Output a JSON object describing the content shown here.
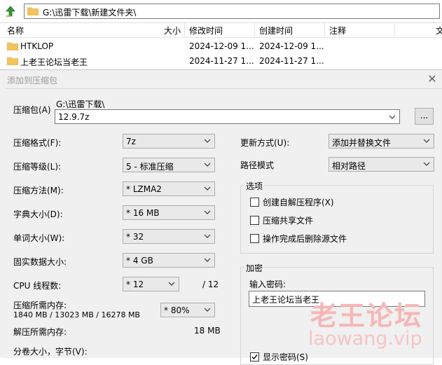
{
  "explorer": {
    "path": "G:\\迅雷下载\\新建文件夹\\",
    "columns": {
      "name": "名称",
      "size": "大小",
      "modified": "修改时间",
      "created": "创建时间",
      "comment": "注释",
      "extra": "文"
    },
    "rows": [
      {
        "name": "HTKLOP",
        "modified": "2024-12-09 1...",
        "created": "2024-12-09 1..."
      },
      {
        "name": "上老王论坛当老王",
        "modified": "2024-11-27 1...",
        "created": "2024-11-27 1..."
      }
    ]
  },
  "dialog": {
    "title": "添加到压缩包",
    "archive_label": "压缩包(A)",
    "archive_dir": "G:\\迅雷下载\\",
    "archive_name": "12.9.7z",
    "browse_label": "...",
    "format_label": "压缩格式(F):",
    "format_value": "7z",
    "level_label": "压缩等级(L):",
    "level_value": "5 - 标准压缩",
    "method_label": "压缩方法(M):",
    "method_value": "* LZMA2",
    "dict_label": "字典大小(D):",
    "dict_value": "* 16 MB",
    "word_label": "单词大小(W):",
    "word_value": "* 32",
    "solid_label": "固实数据大小:",
    "solid_value": "* 4 GB",
    "threads_label": "CPU 线程数:",
    "threads_value": "* 12",
    "threads_total": "/ 12",
    "mem_label": "压缩所需内存:",
    "mem_value": "1840 MB / 13023 MB / 16278 MB",
    "mem_percent": "* 80%",
    "decomp_label": "解压所需内存:",
    "decomp_value": "18 MB",
    "split_label": "分卷大小，字节(V):",
    "update_label": "更新方式(U):",
    "update_value": "添加并替换文件",
    "pathmode_label": "路径模式",
    "pathmode_value": "相对路径",
    "options_title": "选项",
    "opt_sfx": "创建自解压程序(X)",
    "opt_shared": "压缩共享文件",
    "opt_delete": "操作完成后删除源文件",
    "encrypt_title": "加密",
    "password_label": "输入密码:",
    "password_value": "上老王论坛当老王",
    "show_password": "显示密码(S)"
  },
  "watermark": {
    "line1": "老王论坛",
    "line2": "laowang.vip"
  },
  "colors": {
    "folder": "#f2c45a",
    "watermark": "#f6b6b6",
    "up_arrow": "#2f9a2f"
  }
}
